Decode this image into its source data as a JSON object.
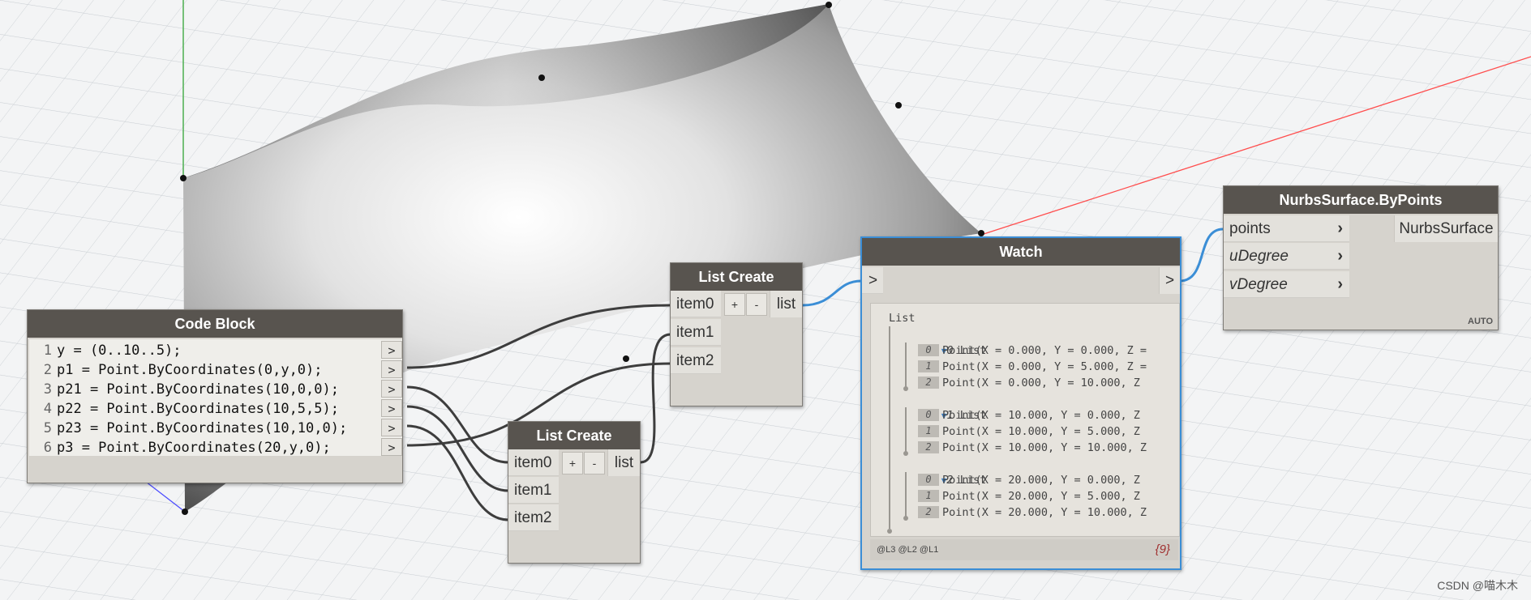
{
  "code_block": {
    "title": "Code Block",
    "lines": [
      {
        "n": "1",
        "code": "y = (0..10..5);"
      },
      {
        "n": "2",
        "code": "p1 = Point.ByCoordinates(0,y,0);"
      },
      {
        "n": "3",
        "code": "p21 = Point.ByCoordinates(10,0,0);"
      },
      {
        "n": "4",
        "code": "p22 = Point.ByCoordinates(10,5,5);"
      },
      {
        "n": "5",
        "code": "p23 = Point.ByCoordinates(10,10,0);"
      },
      {
        "n": "6",
        "code": "p3 = Point.ByCoordinates(20,y,0);"
      }
    ],
    "output_glyph": ">"
  },
  "list_create_small": {
    "title": "List Create",
    "inputs": [
      "item0",
      "item1",
      "item2"
    ],
    "add_label": "+",
    "remove_label": "-",
    "output": "list"
  },
  "list_create_main": {
    "title": "List Create",
    "inputs": [
      "item0",
      "item1",
      "item2"
    ],
    "add_label": "+",
    "remove_label": "-",
    "output": "list"
  },
  "watch": {
    "title": "Watch",
    "in_glyph": ">",
    "out_glyph": ">",
    "root_label": "List",
    "groups": [
      {
        "index": "0",
        "label": "List",
        "items": [
          {
            "i": "0",
            "text": "Point(X = 0.000, Y = 0.000, Z ="
          },
          {
            "i": "1",
            "text": "Point(X = 0.000, Y = 5.000, Z ="
          },
          {
            "i": "2",
            "text": "Point(X = 0.000, Y = 10.000, Z"
          }
        ]
      },
      {
        "index": "1",
        "label": "List",
        "items": [
          {
            "i": "0",
            "text": "Point(X = 10.000, Y = 0.000, Z"
          },
          {
            "i": "1",
            "text": "Point(X = 10.000, Y = 5.000, Z"
          },
          {
            "i": "2",
            "text": "Point(X = 10.000, Y = 10.000, Z"
          }
        ]
      },
      {
        "index": "2",
        "label": "List",
        "items": [
          {
            "i": "0",
            "text": "Point(X = 20.000, Y = 0.000, Z"
          },
          {
            "i": "1",
            "text": "Point(X = 20.000, Y = 5.000, Z"
          },
          {
            "i": "2",
            "text": "Point(X = 20.000, Y = 10.000, Z"
          }
        ]
      }
    ],
    "levels": "@L3 @L2 @L1",
    "count": "{9}"
  },
  "nurbs": {
    "title": "NurbsSurface.ByPoints",
    "inputs": [
      "points",
      "uDegree",
      "vDegree"
    ],
    "output": "NurbsSurface",
    "lacing": "AUTO"
  },
  "credit": "CSDN @喵木木"
}
